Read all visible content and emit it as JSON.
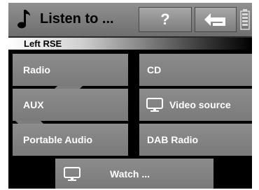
{
  "header": {
    "title": "Listen to ...",
    "help_label": "?",
    "icons": {
      "source": "music-note-icon",
      "back": "back-arrow-icon",
      "battery": "battery-icon"
    }
  },
  "section": {
    "label": "Left RSE"
  },
  "tiles": {
    "radio": "Radio",
    "cd": "CD",
    "aux": "AUX",
    "video_source": "Video source",
    "portable_audio": "Portable Audio",
    "dab_radio": "DAB Radio",
    "watch": "Watch ..."
  },
  "colors": {
    "background": "#000000",
    "tile": "#828282",
    "header": "#808080",
    "text": "#ffffff"
  }
}
